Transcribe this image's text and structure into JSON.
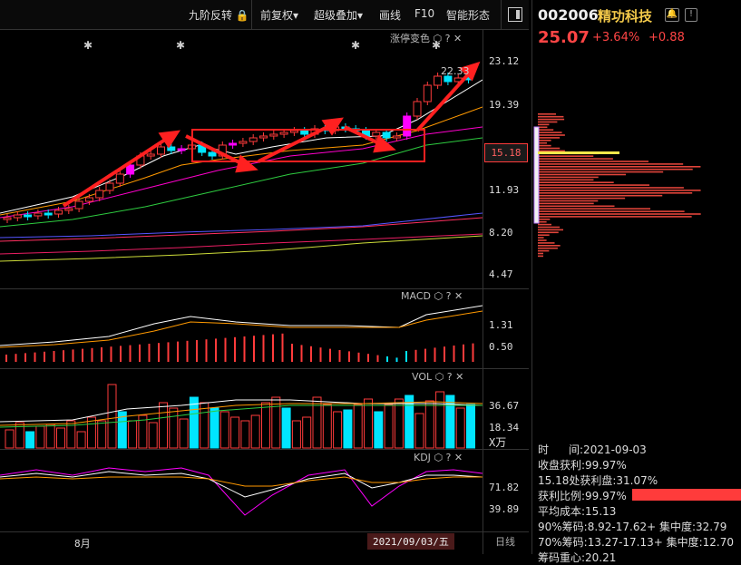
{
  "toolbar": {
    "nine_rev": "九阶反转",
    "fq": "前复权",
    "overlay": "超级叠加",
    "draw": "画线",
    "f10": "F10",
    "smart": "智能形态"
  },
  "main_panel": {
    "title": "涨停变色",
    "y_ticks": [
      "23.12",
      "19.39",
      "15.18",
      "11.93",
      "8.20",
      "4.47"
    ],
    "high_label": "22.33"
  },
  "macd_panel": {
    "title": "MACD",
    "y_ticks": [
      "1.31",
      "0.50"
    ]
  },
  "vol_panel": {
    "title": "VOL",
    "y_ticks": [
      "36.67",
      "18.34"
    ],
    "unit": "X万"
  },
  "kdj_panel": {
    "title": "KDJ",
    "y_ticks": [
      "71.82",
      "39.89"
    ]
  },
  "x_axis": {
    "month": "8月",
    "date_badge": "2021/09/03/五",
    "period": "日线"
  },
  "stock": {
    "code": "002006",
    "name": "精功科技",
    "price": "25.07",
    "pct": "+3.64%",
    "chg": "+0.88"
  },
  "chip_stats": {
    "time_label": "时",
    "time_label2": "间:2021-09-03",
    "close_profit": "收盘获利:99.97%",
    "profit_at": "15.18处获利盘:31.07%",
    "profit_ratio": "获利比例:99.97%",
    "avg_cost": "平均成本:15.13",
    "chip90": "90%筹码:8.92-17.62+ 集中度:32.79",
    "chip70": "70%筹码:13.27-17.13+ 集中度:12.70",
    "cut": "筹码重心:20.21"
  },
  "colors": {
    "up": "#ff3b3b",
    "down": "#00e5ff",
    "limit": "#ff00ff",
    "accent": "#f3c94a"
  }
}
